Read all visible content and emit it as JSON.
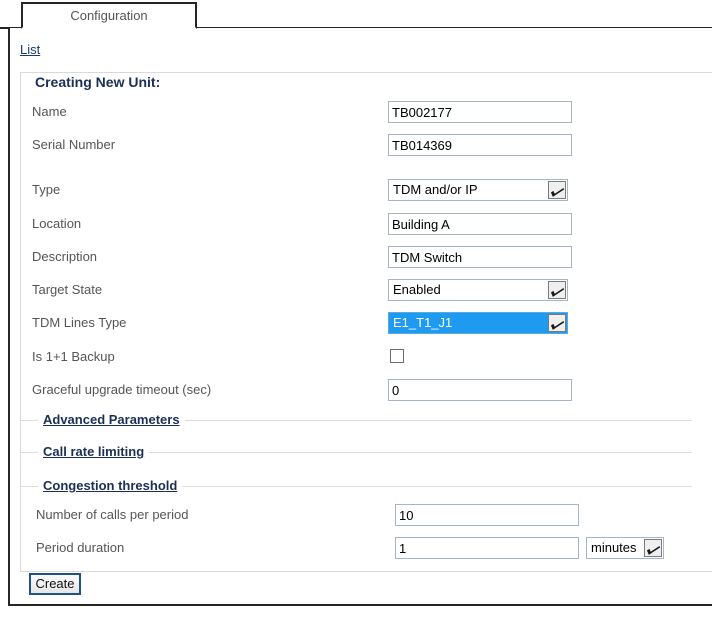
{
  "tabs": [
    {
      "label": "Configuration",
      "active": true
    }
  ],
  "breadcrumb": {
    "list_label": "List"
  },
  "form": {
    "legend": "Creating New Unit:",
    "fields": [
      {
        "label": "Name",
        "type": "text",
        "value": "TB002177"
      },
      {
        "label": "Serial Number",
        "type": "text",
        "value": "TB014369"
      },
      {
        "label": "Type",
        "type": "select",
        "value": "TDM and/or IP"
      },
      {
        "label": "Location",
        "type": "text",
        "value": "Building A"
      },
      {
        "label": "Description",
        "type": "text",
        "value": "TDM Switch"
      },
      {
        "label": "Target State",
        "type": "select",
        "value": "Enabled"
      },
      {
        "label": "TDM Lines Type",
        "type": "select",
        "value": "E1_T1_J1",
        "focused": true
      },
      {
        "label": "Is 1+1 Backup",
        "type": "checkbox",
        "checked": false
      },
      {
        "label": "Graceful upgrade timeout (sec)",
        "type": "text",
        "value": "0"
      }
    ]
  },
  "sections": [
    {
      "legend": "Advanced Parameters",
      "collapsed": true
    },
    {
      "legend": "Call rate limiting",
      "collapsed": true
    },
    {
      "legend": "Congestion threshold",
      "collapsed": false
    }
  ],
  "congestion": {
    "calls_per_period": {
      "label": "Number of calls per period",
      "value": "10"
    },
    "period_duration": {
      "label": "Period duration",
      "value": "1",
      "unit": "minutes"
    }
  },
  "actions": {
    "create_label": "Create"
  },
  "colors": {
    "frame_border": "#262626",
    "fieldset_border": "#d9d9d9",
    "legend_text": "#1b2f55",
    "label_text": "#555555",
    "input_border": "#a6b6c6",
    "focus_highlight": "#1e9bf0",
    "button_focus_border": "#1e5288",
    "link_text": "#1b3a6b"
  }
}
